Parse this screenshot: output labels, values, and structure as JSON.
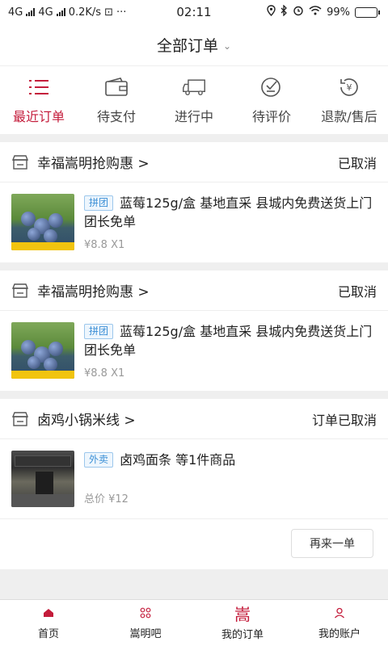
{
  "status_bar": {
    "net1": "4G",
    "net2": "4G",
    "speed": "0.2K/s",
    "extra": "⊡",
    "dots": "···",
    "time": "02:11",
    "battery": "99%",
    "battery_level": 0.99
  },
  "header": {
    "title": "全部订单"
  },
  "tabs": [
    {
      "label": "最近订单",
      "icon": "list-icon",
      "active": true
    },
    {
      "label": "待支付",
      "icon": "wallet-icon"
    },
    {
      "label": "进行中",
      "icon": "truck-icon"
    },
    {
      "label": "待评价",
      "icon": "review-icon"
    },
    {
      "label": "退款/售后",
      "icon": "refund-icon"
    }
  ],
  "orders": [
    {
      "shop": "幸福嵩明抢购惠 >",
      "status": "已取消",
      "tag": "拼团",
      "title": "蓝莓125g/盒 基地直采 县城内免费送货上门 团长免单",
      "price": "¥8.8 X1"
    },
    {
      "shop": "幸福嵩明抢购惠 >",
      "status": "已取消",
      "tag": "拼团",
      "title": "蓝莓125g/盒 基地直采 县城内免费送货上门 团长免单",
      "price": "¥8.8 X1"
    },
    {
      "shop": "卤鸡小锅米线 >",
      "status": "订单已取消",
      "tag": "外卖",
      "title": "卤鸡面条 等1件商品",
      "price": "总价 ¥12",
      "button": "再来一单"
    }
  ],
  "bottom_nav": [
    {
      "label": "首页",
      "icon": "home-icon"
    },
    {
      "label": "嵩明吧",
      "icon": "grid-icon"
    },
    {
      "label": "我的订单",
      "icon": "logo-icon",
      "glyph": "嵩",
      "active": true
    },
    {
      "label": "我的账户",
      "icon": "user-icon"
    }
  ],
  "colors": {
    "accent": "#c41c3b",
    "tag_blue": "#3b8fd6"
  }
}
